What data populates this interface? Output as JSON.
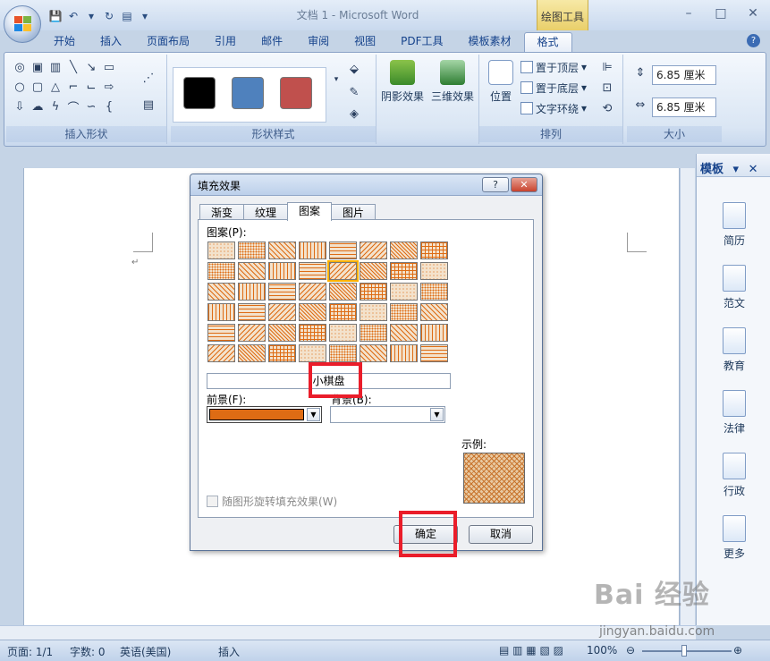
{
  "window": {
    "doc_title": "文档 1 - Microsoft Word",
    "context_title": "绘图工具",
    "controls": [
      "–",
      "□",
      "✕"
    ]
  },
  "tabs": [
    "开始",
    "插入",
    "页面布局",
    "引用",
    "邮件",
    "审阅",
    "视图",
    "PDF工具",
    "模板素材",
    "格式"
  ],
  "active_tab": "格式",
  "ribbon": {
    "insert_shapes_label": "插入形状",
    "shape_styles_label": "形状样式",
    "shape_swatches": [
      "#000000",
      "#4f81bd",
      "#c0504d"
    ],
    "shadow_label": "阴影效果",
    "threed_label": "三维效果",
    "arrange_label": "排列",
    "position_label": "位置",
    "bring_front": "置于顶层",
    "send_back": "置于底层",
    "text_wrap": "文字环绕",
    "size_label": "大小",
    "height_value": "6.85 厘米",
    "width_value": "6.85 厘米"
  },
  "taskpane": {
    "title": "模板",
    "items": [
      "简历",
      "范文",
      "教育",
      "法律",
      "行政",
      "更多"
    ]
  },
  "dialog": {
    "title": "填充效果",
    "help": "?",
    "close": "✕",
    "tabs": [
      "渐变",
      "纹理",
      "图案",
      "图片"
    ],
    "active_tab": "图案",
    "pattern_label": "图案(P):",
    "selected_pattern": "小棋盘",
    "fg_label": "前景(F):",
    "fg_color": "#de6c14",
    "bg_label": "背景(B):",
    "sample_label": "示例:",
    "rotate_label": "随图形旋转填充效果(W)",
    "ok": "确定",
    "cancel": "取消"
  },
  "status": {
    "page": "页面: 1/1",
    "words": "字数: 0",
    "language": "英语(美国)",
    "mode": "插入",
    "zoom": "100%"
  },
  "watermark": {
    "main": "Bai 经验",
    "sub": "jingyan.baidu.com"
  },
  "colors": {
    "pattern_fg": "#de6c14",
    "highlight": "#ea1d2a"
  }
}
